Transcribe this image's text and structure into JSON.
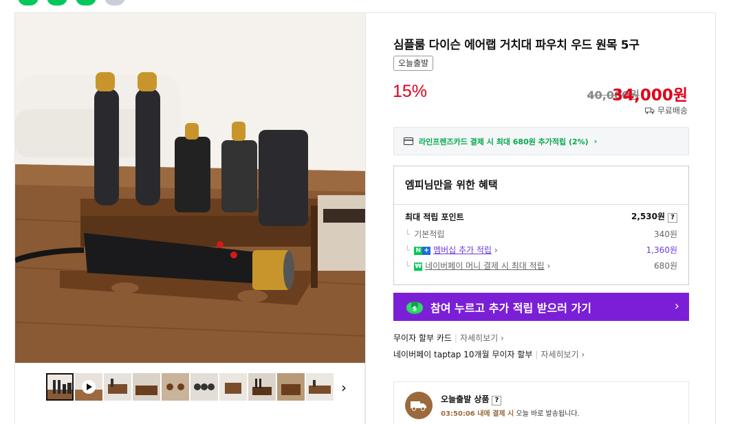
{
  "product": {
    "title": "심플룸 다이슨 에어랩 거치대 파우치 우드 원목 5구",
    "badge": "오늘출발",
    "discount": "15%",
    "original_price": "40,000원",
    "sale_price": "34,000원",
    "shipping": "무료배송"
  },
  "card_promo": {
    "text": "라인프렌즈카드 결제 시 최대 680원 추가적립 (2%)",
    "icon": "credit-card-icon"
  },
  "benefits": {
    "title": "엠피님만을 위한 혜택",
    "max_points_label": "최대 적립 포인트",
    "max_points_value": "2,530원",
    "help": "?",
    "rows": [
      {
        "label": "기본적립",
        "value": "340원"
      },
      {
        "label": "멤버십 추가 적립",
        "value": "1,360원"
      },
      {
        "label": "네이버페이 머니 결제 시 최대 적립",
        "value": "680원"
      }
    ]
  },
  "cta": {
    "label": "참여 누르고 추가 적립 받으러 가기",
    "color": "#7b1fd6"
  },
  "payments": [
    {
      "label": "무이자 할부 카드",
      "more": "자세히보기"
    },
    {
      "label": "네이버페이 taptap 10개월 무이자 할부",
      "more": "자세히보기"
    }
  ],
  "today": {
    "title": "오늘출발 상품",
    "help": "?",
    "time": "03:50:06",
    "desc_rest": " 내에 결제 시 오늘 바로 발송됩니다."
  },
  "gallery": {
    "thumbnail_count": 10,
    "next_icon": "chevron-right-icon"
  },
  "colors": {
    "accent_red": "#e1001a",
    "naver_green": "#03c75a",
    "purple": "#7b1fd6"
  }
}
